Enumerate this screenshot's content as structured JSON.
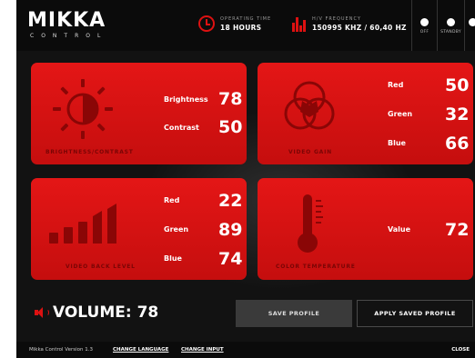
{
  "header": {
    "logo": "MIKKA",
    "logo_sub": "CONTROL",
    "operating_time": {
      "label": "OPERATING TIME",
      "value": "18 HOURS"
    },
    "hv_frequency": {
      "label": "H/V FREQUENCY",
      "value": "150995 KHZ / 60,40 HZ"
    },
    "buttons": [
      {
        "label": "OFF"
      },
      {
        "label": "STANDBY"
      }
    ]
  },
  "cards": {
    "brightness_contrast": {
      "title": "BRIGHTNESS/CONTRAST",
      "rows": [
        {
          "label": "Brightness",
          "value": "78"
        },
        {
          "label": "Contrast",
          "value": "50"
        }
      ]
    },
    "video_gain": {
      "title": "VIDEO GAIN",
      "rows": [
        {
          "label": "Red",
          "value": "50"
        },
        {
          "label": "Green",
          "value": "32"
        },
        {
          "label": "Blue",
          "value": "66"
        }
      ]
    },
    "video_back_level": {
      "title": "VIDEO BACK LEVEL",
      "rows": [
        {
          "label": "Red",
          "value": "22"
        },
        {
          "label": "Green",
          "value": "89"
        },
        {
          "label": "Blue",
          "value": "74"
        }
      ]
    },
    "color_temperature": {
      "title": "COLOR TEMPERATURE",
      "rows": [
        {
          "label": "Value",
          "value": "72"
        }
      ]
    }
  },
  "volume": {
    "text": "VOLUME: 78"
  },
  "actions": {
    "save_label": "SAVE PROFILE",
    "apply_label": "APPLY SAVED PROFILE"
  },
  "footer": {
    "version": "Mikka Control Version 1.3",
    "change_language": "CHANGE LANGUAGE",
    "change_input": "CHANGE INPUT",
    "close": "CLOSE"
  },
  "colors": {
    "accent": "#e41616",
    "card_title": "#7a0505",
    "background": "#121212"
  },
  "icons": {
    "operating_time": "clock-icon",
    "hv_frequency": "frequency-icon",
    "brightness": "brightness-contrast-icon",
    "video_gain": "rgb-circles-icon",
    "back_level": "signal-bars-icon",
    "temperature": "thermometer-icon",
    "volume": "speaker-icon"
  }
}
